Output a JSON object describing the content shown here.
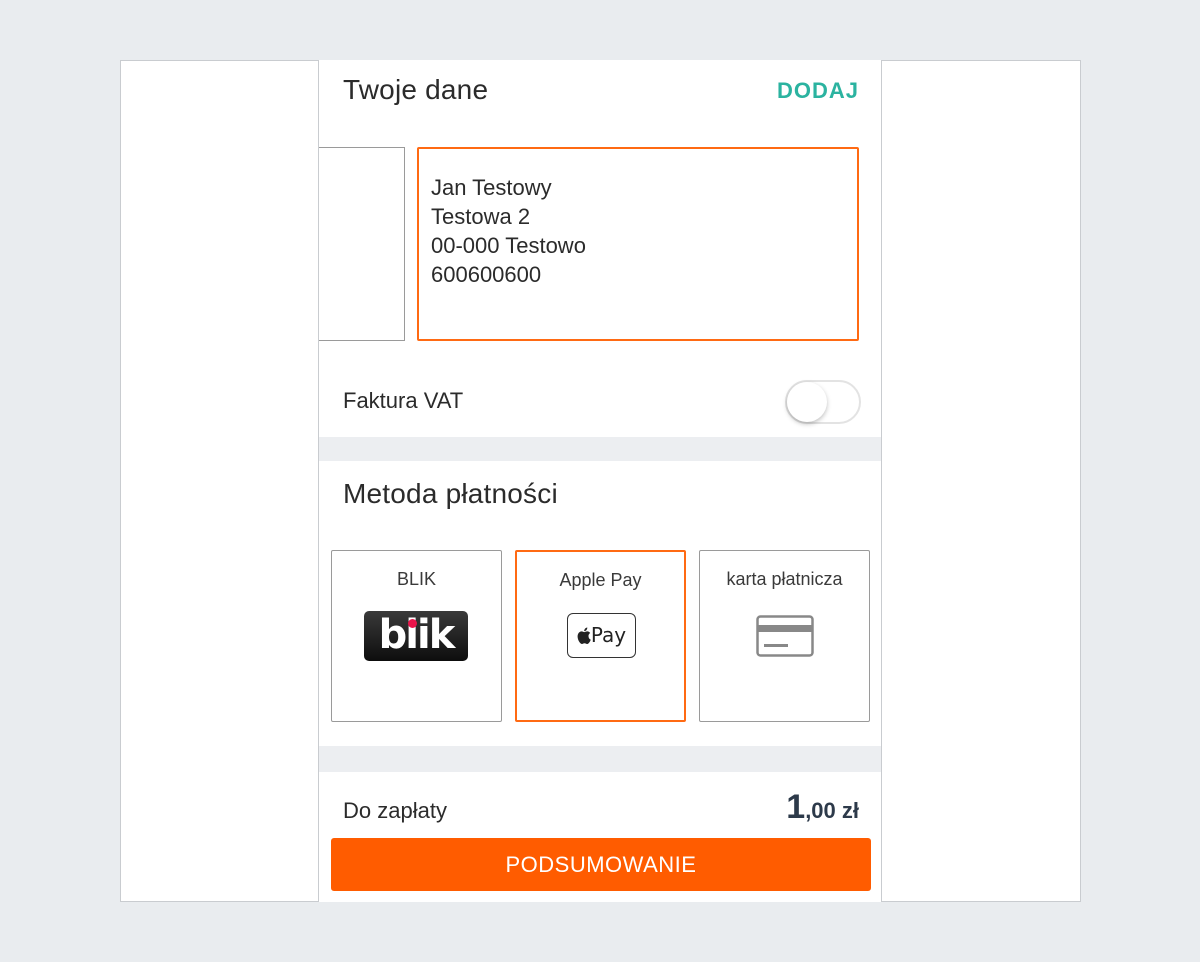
{
  "your_data": {
    "title": "Twoje dane",
    "add_label": "DODAJ",
    "address_lines": [
      "Jan Testowy",
      "Testowa 2",
      "00-000 Testowo",
      "600600600"
    ]
  },
  "invoice": {
    "label": "Faktura VAT",
    "enabled": false
  },
  "payment": {
    "title": "Metoda płatności",
    "methods": [
      {
        "label": "BLIK",
        "logo_text": "blik",
        "icon": "blik-logo",
        "selected": false
      },
      {
        "label": "Apple Pay",
        "logo_text": "Pay",
        "icon": "apple-pay-logo",
        "selected": true
      },
      {
        "label": "karta płatnicza",
        "icon": "credit-card-icon",
        "selected": false
      }
    ]
  },
  "total": {
    "label": "Do zapłaty",
    "amount_int": "1",
    "amount_dec": ",00 zł"
  },
  "summary_button": "PODSUMOWANIE",
  "colors": {
    "accent": "#ff6a13",
    "button": "#ff5c00",
    "link": "#2bb3a0",
    "amount": "#2d3a4a"
  }
}
